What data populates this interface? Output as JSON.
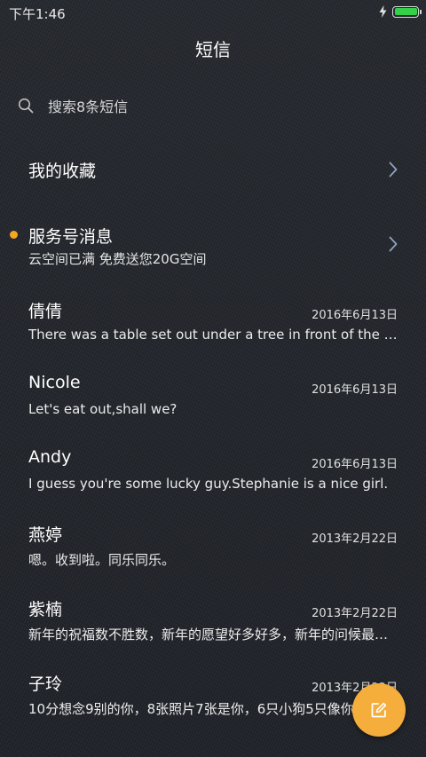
{
  "status_bar": {
    "time": "下午1:46",
    "icons": [
      "charging-bolt-icon",
      "battery-icon"
    ],
    "battery_level": 1.0,
    "battery_color": "#35d04a"
  },
  "header": {
    "title": "短信"
  },
  "search": {
    "icon": "search-icon",
    "placeholder": "搜索8条短信"
  },
  "favorites": {
    "label": "我的收藏",
    "icon": "chevron-right-icon"
  },
  "service": {
    "title": "服务号消息",
    "subtitle": "云空间已满 免费送您20G空间",
    "unread": true,
    "unread_color": "#f5a623",
    "icon": "chevron-right-icon"
  },
  "conversations": [
    {
      "name": "倩倩",
      "date": "2016年6月13日",
      "preview": "There was a table set out under a tree in front of the house"
    },
    {
      "name": "Nicole",
      "date": "2016年6月13日",
      "preview": "Let's eat out,shall we?"
    },
    {
      "name": "Andy",
      "date": "2016年6月13日",
      "preview": "I guess you're some lucky guy.Stephanie is a nice girl."
    },
    {
      "name": "燕婷",
      "date": "2013年2月22日",
      "preview": "嗯。收到啦。同乐同乐。"
    },
    {
      "name": "紫楠",
      "date": "2013年2月22日",
      "preview": "新年的祝福数不胜数，新年的愿望好多好多，新年的问候最真最诚"
    },
    {
      "name": "子玲",
      "date": "2013年2月22日",
      "preview": "10分想念9别的你，8张照片7张是你，6只小狗5只像你"
    }
  ],
  "fab": {
    "icon": "compose-icon",
    "color": "#f5ad3c"
  }
}
